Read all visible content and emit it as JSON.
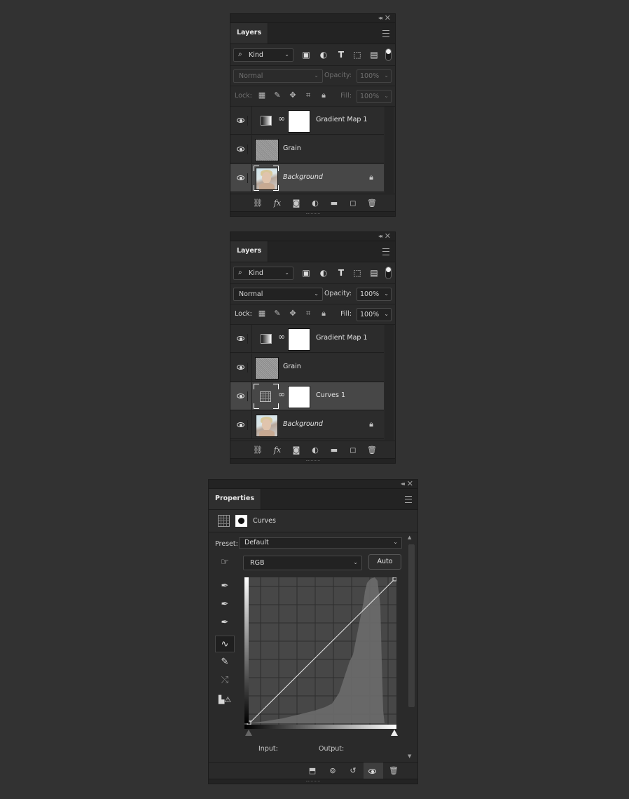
{
  "panel_common": {
    "collapse_glyph": "◂◂",
    "close_glyph": "✕"
  },
  "layers_top": {
    "tab": "Layers",
    "filter": {
      "kind_label": "Kind"
    },
    "blend_mode": "Normal",
    "opacity_label": "Opacity:",
    "opacity_value": "100%",
    "lock_label": "Lock:",
    "fill_label": "Fill:",
    "fill_value": "100%",
    "layers": [
      {
        "name": "Gradient Map 1"
      },
      {
        "name": "Grain"
      },
      {
        "name": "Background"
      }
    ]
  },
  "layers_bottom": {
    "tab": "Layers",
    "filter": {
      "kind_label": "Kind"
    },
    "blend_mode": "Normal",
    "opacity_label": "Opacity:",
    "opacity_value": "100%",
    "lock_label": "Lock:",
    "fill_label": "Fill:",
    "fill_value": "100%",
    "layers": [
      {
        "name": "Gradient Map 1"
      },
      {
        "name": "Grain"
      },
      {
        "name": "Curves 1"
      },
      {
        "name": "Background"
      }
    ]
  },
  "properties": {
    "tab": "Properties",
    "title": "Curves",
    "preset_label": "Preset:",
    "preset_value": "Default",
    "channel": "RGB",
    "auto_label": "Auto",
    "input_label": "Input:",
    "output_label": "Output:"
  },
  "icons": {
    "fx": "fx"
  }
}
